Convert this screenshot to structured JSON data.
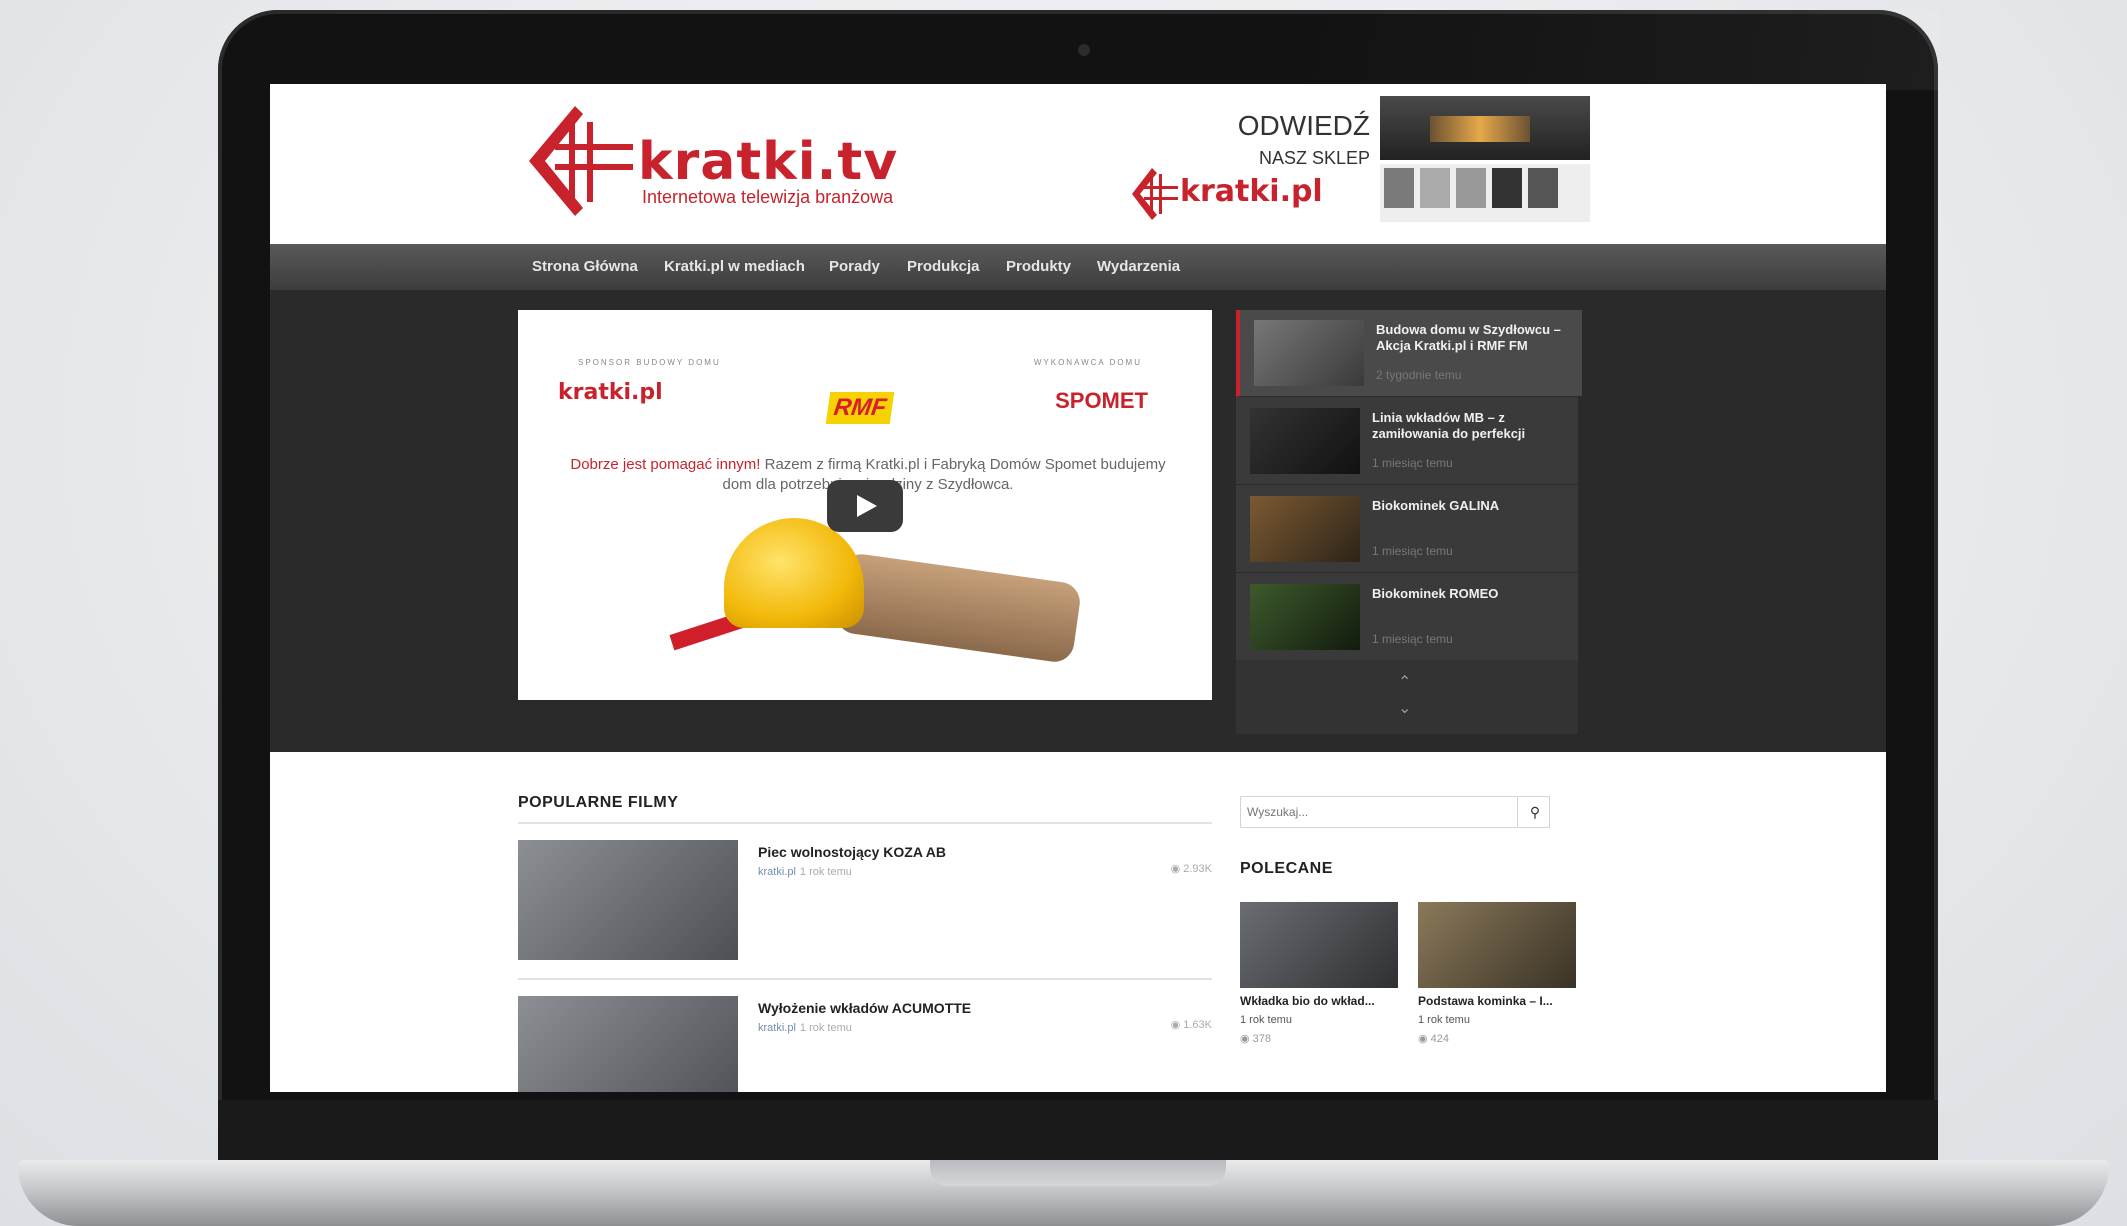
{
  "header": {
    "logo_title": "kratki.tv",
    "logo_subtitle": "Internetowa telewizja branżowa",
    "ad": {
      "visit": "ODWIEDŹ",
      "shop": "NASZ SKLEP",
      "logo_text": "kratki.pl"
    }
  },
  "nav": {
    "items": [
      "Strona Główna",
      "Kratki.pl w mediach",
      "Porady",
      "Produkcja",
      "Produkty",
      "Wydarzenia"
    ]
  },
  "hero": {
    "video": {
      "sponsor_left": "SPONSOR BUDOWY DOMU",
      "sponsor_right": "WYKONAWCA DOMU",
      "logo_kratki": "kratki.pl",
      "logo_rmf": "RMF",
      "logo_spomet": "SPOMET",
      "text_highlight": "Dobrze jest pomagać innym!",
      "text_rest": " Razem z firmą Kratki.pl i Fabryką Domów Spomet budujemy dom dla potrzebującej rodziny z Szydłowca."
    },
    "playlist": [
      {
        "title": "Budowa domu w Szydłowcu – Akcja Kratki.pl i RMF FM",
        "time": "2 tygodnie temu"
      },
      {
        "title": "Linia wkładów MB – z zamiłowania do perfekcji",
        "time": "1 miesiąc temu"
      },
      {
        "title": "Biokominek GALINA",
        "time": "1 miesiąc temu"
      },
      {
        "title": "Biokominek ROMEO",
        "time": "1 miesiąc temu"
      }
    ]
  },
  "popular": {
    "title": "POPULARNE FILMY",
    "videos": [
      {
        "title": "Piec wolnostojący KOZA AB",
        "author": "kratki.pl",
        "time": "1 rok temu",
        "views": "2.93K"
      },
      {
        "title": "Wyłożenie wkładów ACUMOTTE",
        "author": "kratki.pl",
        "time": "1 rok temu",
        "views": "1.63K"
      }
    ]
  },
  "sidebar": {
    "search_placeholder": "Wyszukaj...",
    "recommended_title": "POLECANE",
    "recommended": [
      {
        "title": "Wkładka bio do wkład...",
        "time": "1 rok temu",
        "views": "378"
      },
      {
        "title": "Podstawa kominka – I...",
        "time": "1 rok temu",
        "views": "424"
      }
    ]
  },
  "colors": {
    "brand_red": "#c8232c",
    "nav_bg": "#4a4a4a",
    "hero_bg": "#2a2a2a"
  }
}
